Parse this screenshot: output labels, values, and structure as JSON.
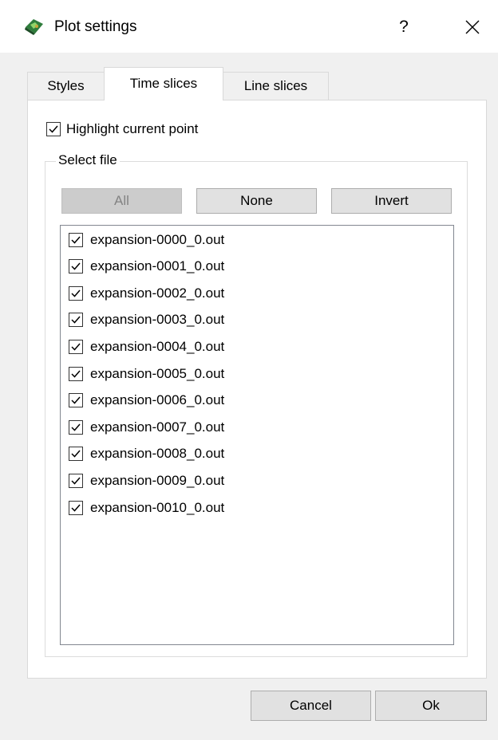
{
  "window": {
    "title": "Plot settings",
    "help_label": "?",
    "close_label": "✕"
  },
  "tabs": [
    {
      "label": "Styles",
      "active": false
    },
    {
      "label": "Time slices",
      "active": true
    },
    {
      "label": "Line slices",
      "active": false
    }
  ],
  "highlight_current_point": {
    "label": "Highlight current point",
    "checked": true
  },
  "select_file": {
    "title": "Select file",
    "buttons": {
      "all": {
        "label": "All",
        "enabled": false
      },
      "none": {
        "label": "None",
        "enabled": true
      },
      "invert": {
        "label": "Invert",
        "enabled": true
      }
    },
    "files": [
      {
        "name": "expansion-0000_0.out",
        "checked": true
      },
      {
        "name": "expansion-0001_0.out",
        "checked": true
      },
      {
        "name": "expansion-0002_0.out",
        "checked": true
      },
      {
        "name": "expansion-0003_0.out",
        "checked": true
      },
      {
        "name": "expansion-0004_0.out",
        "checked": true
      },
      {
        "name": "expansion-0005_0.out",
        "checked": true
      },
      {
        "name": "expansion-0006_0.out",
        "checked": true
      },
      {
        "name": "expansion-0007_0.out",
        "checked": true
      },
      {
        "name": "expansion-0008_0.out",
        "checked": true
      },
      {
        "name": "expansion-0009_0.out",
        "checked": true
      },
      {
        "name": "expansion-0010_0.out",
        "checked": true
      }
    ]
  },
  "footer": {
    "cancel_label": "Cancel",
    "ok_label": "Ok"
  }
}
